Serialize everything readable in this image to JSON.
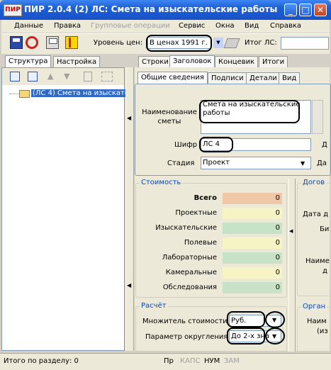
{
  "window": {
    "app_icon_text": "ПИР",
    "title": "ПИР 2.0.4  (2) ЛС: Смета на изыскательские работы"
  },
  "menu": [
    "Данные",
    "Правка",
    "Групповые операции",
    "Сервис",
    "Окна",
    "Вид",
    "Справка"
  ],
  "toolbar": {
    "price_level_label": "Уровень цен:",
    "price_level_value": "В ценах 1991 г.",
    "total_label": "Итог ЛС:"
  },
  "left_panel": {
    "tabs": [
      "Структура",
      "Настройка"
    ],
    "tree_item": "(ЛС 4) Смета на изыскате"
  },
  "main_tabs": [
    "Строки",
    "Заголовок",
    "Концевик",
    "Итоги"
  ],
  "sub_tabs": [
    "Общие сведения",
    "Подписи",
    "Детали",
    "Вид"
  ],
  "general": {
    "name_label": "Наименование сметы",
    "name_value": "Смета на изыскательские работы",
    "code_label": "Шифр",
    "code_value": "ЛС 4",
    "stage_label": "Стадия",
    "stage_value": "Проект",
    "right_clip_1": "Д",
    "right_clip_2": "Да"
  },
  "cost": {
    "title": "Стоимость",
    "rows": [
      {
        "label": "Всего",
        "value": "0",
        "color": "#f0c8a8"
      },
      {
        "label": "Проектные",
        "value": "0",
        "color": "#f6f3c4"
      },
      {
        "label": "Изыскательские",
        "value": "0",
        "color": "#c8e2c8"
      },
      {
        "label": "Полевые",
        "value": "0",
        "color": "#f6f3c4"
      },
      {
        "label": "Лабораторные",
        "value": "0",
        "color": "#c8e2c8"
      },
      {
        "label": "Камеральные",
        "value": "0",
        "color": "#f6f3c4"
      },
      {
        "label": "Обследования",
        "value": "0",
        "color": "#c8e2c8"
      }
    ]
  },
  "calc": {
    "title": "Расчёт",
    "multiplier_label": "Множитель стоимости",
    "multiplier_value": "Руб.",
    "rounding_label": "Параметр округления",
    "rounding_value": "До 2-х зна"
  },
  "right_clipped": {
    "contract_title": "Догов",
    "date_label": "Дата д",
    "line2": "Би",
    "line3": "Наиме",
    "line4": "д",
    "org_title": "Орган",
    "org_line1": "Наим",
    "org_line2": "(из"
  },
  "status": {
    "text": "Итого по разделу: 0",
    "cells": [
      "Пр",
      "КАПС",
      "НУМ",
      "ЗАМ"
    ]
  }
}
